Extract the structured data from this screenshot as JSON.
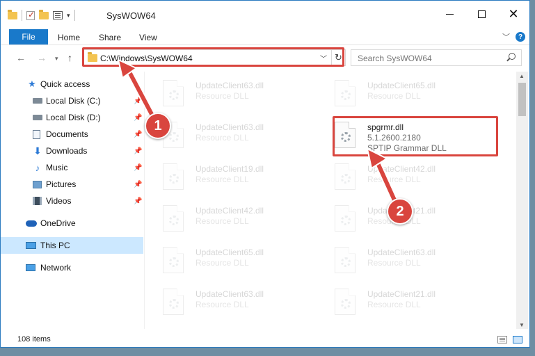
{
  "window": {
    "title": "SysWOW64",
    "qa_toolbar": [
      "folder-icon",
      "properties-check-icon",
      "folder-icon",
      "properties-icon",
      "customize-caret"
    ],
    "controls": [
      "minimize",
      "maximize",
      "close"
    ]
  },
  "ribbon": {
    "file": "File",
    "tabs": [
      "Home",
      "Share",
      "View"
    ],
    "help": "?"
  },
  "nav": {
    "path": "C:\\Windows\\SysWOW64",
    "search_placeholder": "Search SysWOW64"
  },
  "sidebar": {
    "quick_access": "Quick access",
    "items": [
      {
        "label": "Local Disk (C:)",
        "icon": "drive-icon",
        "pinned": true
      },
      {
        "label": "Local Disk (D:)",
        "icon": "drive-icon",
        "pinned": true
      },
      {
        "label": "Documents",
        "icon": "documents-icon",
        "pinned": true
      },
      {
        "label": "Downloads",
        "icon": "download-icon",
        "pinned": true
      },
      {
        "label": "Music",
        "icon": "music-icon",
        "pinned": true
      },
      {
        "label": "Pictures",
        "icon": "pictures-icon",
        "pinned": true
      },
      {
        "label": "Videos",
        "icon": "videos-icon",
        "pinned": true
      }
    ],
    "onedrive": "OneDrive",
    "this_pc": "This PC",
    "network": "Network"
  },
  "files": [
    {
      "name": "UpdateClient63.dll",
      "line1": "Resource DLL",
      "line2": "",
      "faded": true
    },
    {
      "name": "UpdateClient65.dll",
      "line1": "Resource DLL",
      "line2": "",
      "faded": true
    },
    {
      "name": "UpdateClient63.dll",
      "line1": "Resource DLL",
      "line2": "",
      "faded": true
    },
    {
      "name": "spgrmr.dll",
      "line1": "5.1.2600.2180",
      "line2": "SPTIP Grammar DLL",
      "faded": false
    },
    {
      "name": "UpdateClient19.dll",
      "line1": "Resource DLL",
      "line2": "",
      "faded": true
    },
    {
      "name": "UpdateClient42.dll",
      "line1": "Resource DLL",
      "line2": "",
      "faded": true
    },
    {
      "name": "UpdateClient42.dll",
      "line1": "Resource DLL",
      "line2": "",
      "faded": true
    },
    {
      "name": "UpdateClient21.dll",
      "line1": "Resource DLL",
      "line2": "",
      "faded": true
    },
    {
      "name": "UpdateClient65.dll",
      "line1": "Resource DLL",
      "line2": "",
      "faded": true
    },
    {
      "name": "UpdateClient63.dll",
      "line1": "Resource DLL",
      "line2": "",
      "faded": true
    },
    {
      "name": "UpdateClient63.dll",
      "line1": "Resource DLL",
      "line2": "",
      "faded": true
    },
    {
      "name": "UpdateClient21.dll",
      "line1": "Resource DLL",
      "line2": "",
      "faded": true
    }
  ],
  "status": {
    "count": "108 items"
  },
  "callouts": [
    "1",
    "2"
  ],
  "colors": {
    "accent": "#1979ca",
    "highlight": "#d9453e",
    "selected": "#cce8ff"
  }
}
